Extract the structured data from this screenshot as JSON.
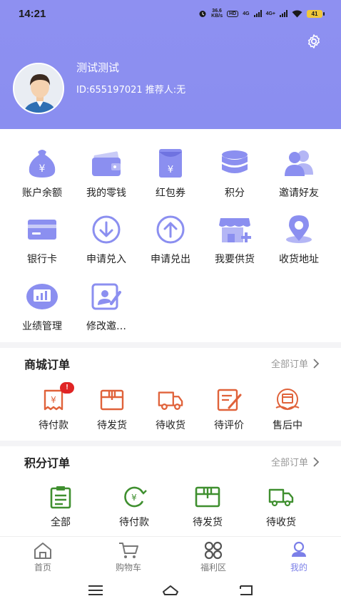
{
  "status": {
    "time": "14:21",
    "net_speed_value": "36.6",
    "net_speed_unit": "KB/s",
    "hd": "HD",
    "sig1": "4G",
    "sig2": "4G+",
    "battery": "41"
  },
  "colors": {
    "header_bg": "#8b8ff0",
    "accent": "#7b7fe8",
    "order_orange": "#e0623a",
    "points_green": "#3f8f2f"
  },
  "user": {
    "name": "测试测试",
    "id_line": "ID:655197021 推荐人:无"
  },
  "menu": [
    {
      "label": "账户余额",
      "icon": "money-bag-icon"
    },
    {
      "label": "我的零钱",
      "icon": "wallet-icon"
    },
    {
      "label": "红包券",
      "icon": "red-envelope-icon"
    },
    {
      "label": "积分",
      "icon": "coins-stack-icon"
    },
    {
      "label": "邀请好友",
      "icon": "invite-friends-icon"
    },
    {
      "label": "银行卡",
      "icon": "bank-card-icon"
    },
    {
      "label": "申请兑入",
      "icon": "arrow-down-circle-icon"
    },
    {
      "label": "申请兑出",
      "icon": "arrow-up-circle-icon"
    },
    {
      "label": "我要供货",
      "icon": "store-add-icon"
    },
    {
      "label": "收货地址",
      "icon": "location-pin-icon"
    },
    {
      "label": "业绩管理",
      "icon": "performance-chart-icon"
    },
    {
      "label": "修改邀…",
      "icon": "edit-invite-icon"
    }
  ],
  "mall_orders": {
    "title": "商城订单",
    "all_link": "全部订单",
    "items": [
      {
        "label": "待付款",
        "icon": "pending-payment-icon",
        "badge": "!"
      },
      {
        "label": "待发货",
        "icon": "pending-shipment-icon"
      },
      {
        "label": "待收货",
        "icon": "delivery-truck-icon"
      },
      {
        "label": "待评价",
        "icon": "review-edit-icon"
      },
      {
        "label": "售后中",
        "icon": "after-sales-icon"
      }
    ]
  },
  "points_orders": {
    "title": "积分订单",
    "all_link": "全部订单",
    "items": [
      {
        "label": "全部",
        "icon": "clipboard-icon"
      },
      {
        "label": "待付款",
        "icon": "yen-cycle-icon"
      },
      {
        "label": "待发货",
        "icon": "package-icon"
      },
      {
        "label": "待收货",
        "icon": "truck-icon"
      }
    ]
  },
  "tabs": [
    {
      "label": "首页",
      "icon": "home-icon"
    },
    {
      "label": "购物车",
      "icon": "cart-icon"
    },
    {
      "label": "福利区",
      "icon": "welfare-icon"
    },
    {
      "label": "我的",
      "icon": "profile-icon"
    }
  ]
}
